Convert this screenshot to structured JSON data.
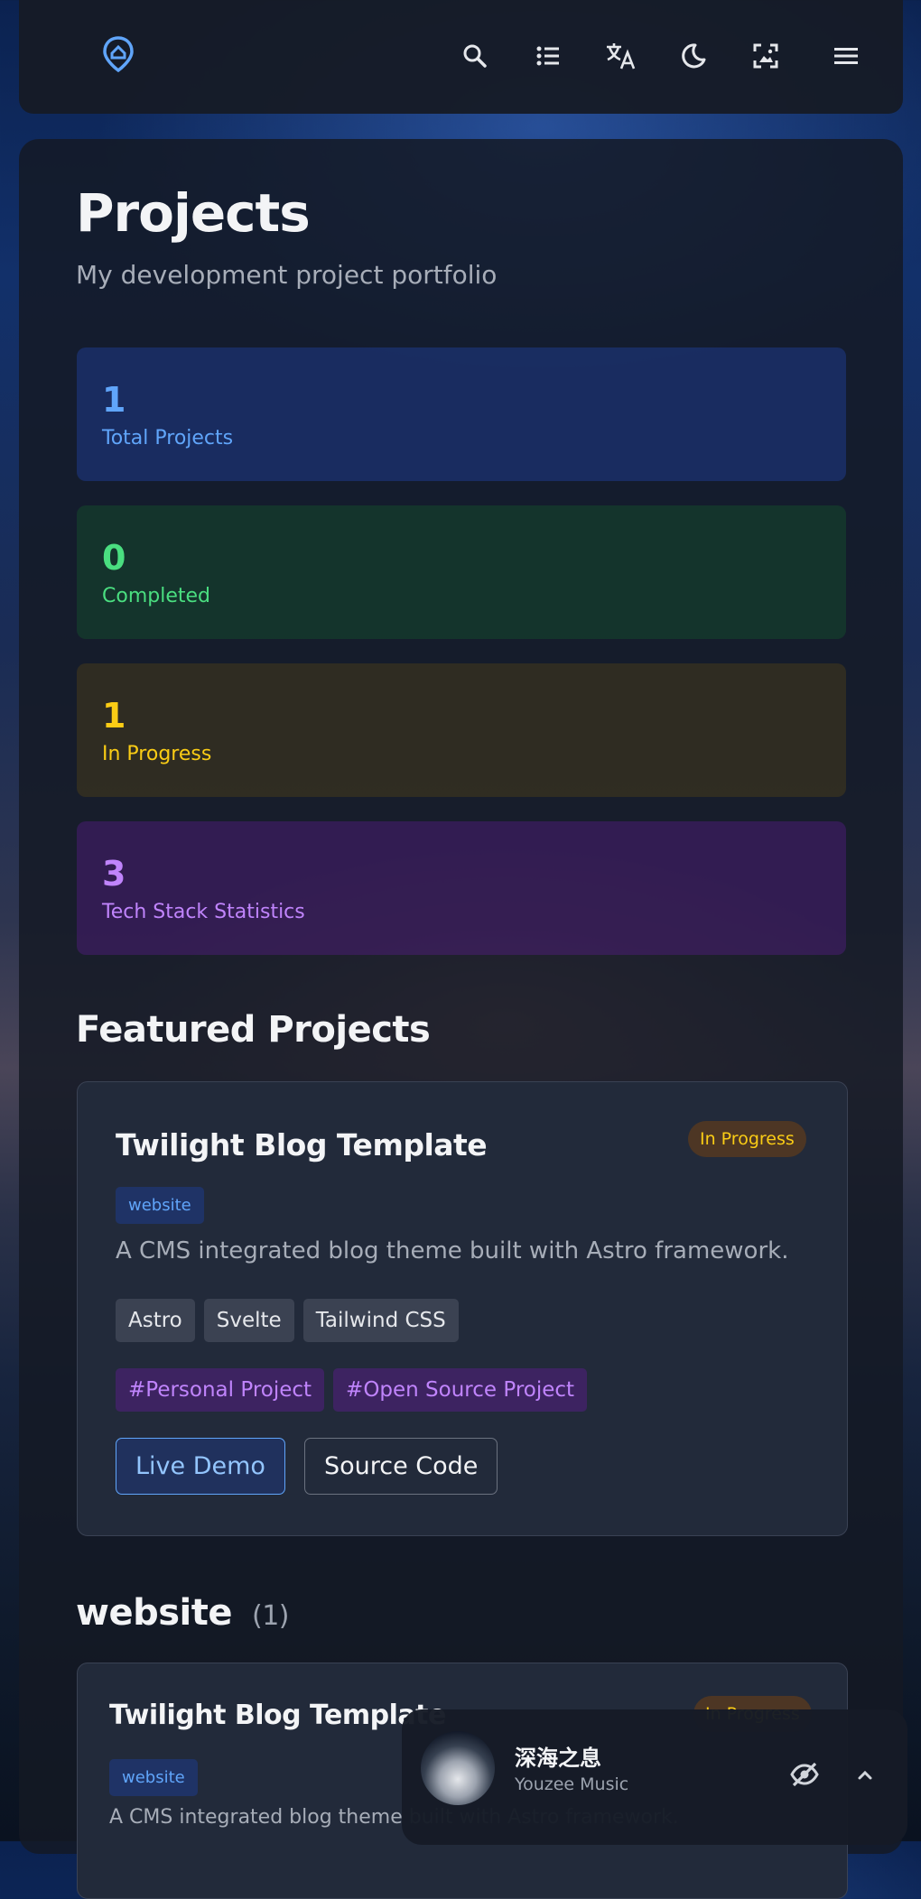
{
  "header": {
    "logo_icon": "map-pin-home-icon",
    "icons": [
      "search-icon",
      "list-icon",
      "translate-icon",
      "moon-icon",
      "wallpaper-icon",
      "menu-icon"
    ]
  },
  "page": {
    "title": "Projects",
    "subtitle": "My development project portfolio"
  },
  "stats": [
    {
      "value": "1",
      "label": "Total Projects",
      "color": "#60a5fa"
    },
    {
      "value": "0",
      "label": "Completed",
      "color": "#4ade80"
    },
    {
      "value": "1",
      "label": "In Progress",
      "color": "#facc15"
    },
    {
      "value": "3",
      "label": "Tech Stack Statistics",
      "color": "#c084fc"
    }
  ],
  "featured": {
    "heading": "Featured Projects",
    "project": {
      "title": "Twilight Blog Template",
      "status": "In Progress",
      "category": "website",
      "description": "A CMS integrated blog theme built with Astro framework.",
      "tech": [
        "Astro",
        "Svelte",
        "Tailwind CSS"
      ],
      "tags": [
        "#Personal Project",
        "#Open Source Project"
      ],
      "live_demo": "Live Demo",
      "source_code": "Source Code"
    }
  },
  "category_section": {
    "heading": "website",
    "count": "(1)",
    "project": {
      "title": "Twilight Blog Template",
      "status": "In Progress",
      "category": "website",
      "description": "A CMS integrated blog theme built with Astro framework."
    }
  },
  "player": {
    "title": "深海之息",
    "artist": "Youzee Music",
    "hide_icon": "eye-off-icon",
    "expand_icon": "chevron-up-icon"
  }
}
